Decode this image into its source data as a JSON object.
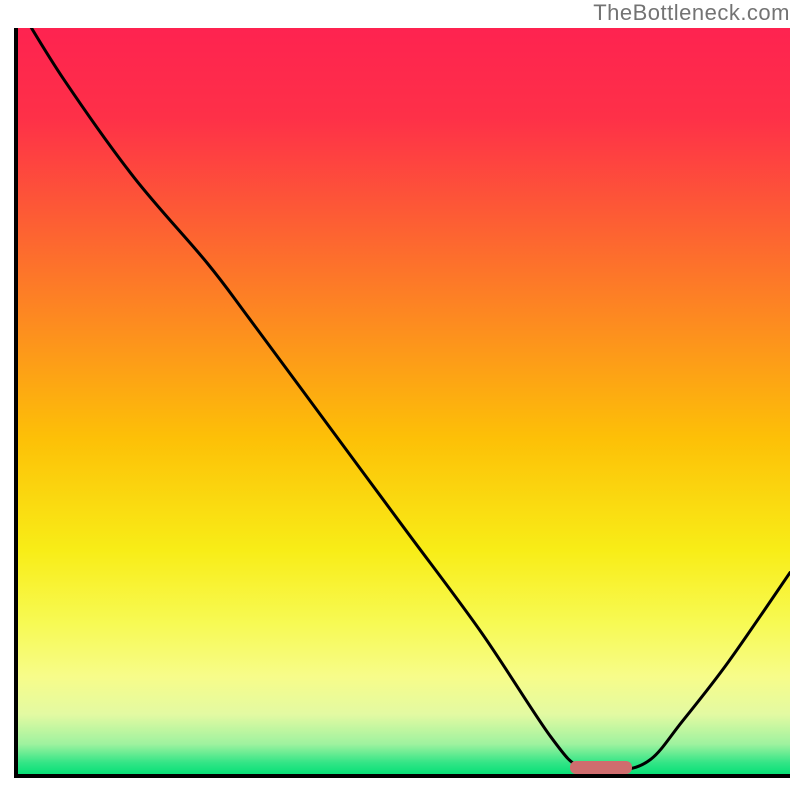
{
  "watermark": "TheBottleneck.com",
  "chart_data": {
    "type": "line",
    "title": "",
    "xlabel": "",
    "ylabel": "",
    "xlim": [
      0,
      100
    ],
    "ylim": [
      0,
      100
    ],
    "gradient_stops": [
      {
        "offset": 0.0,
        "color": "#fe2350"
      },
      {
        "offset": 0.12,
        "color": "#fe3048"
      },
      {
        "offset": 0.25,
        "color": "#fd5b35"
      },
      {
        "offset": 0.4,
        "color": "#fd8d1f"
      },
      {
        "offset": 0.55,
        "color": "#fdc007"
      },
      {
        "offset": 0.7,
        "color": "#f8ed17"
      },
      {
        "offset": 0.8,
        "color": "#f7fa55"
      },
      {
        "offset": 0.87,
        "color": "#f7fc8a"
      },
      {
        "offset": 0.92,
        "color": "#e3faa2"
      },
      {
        "offset": 0.96,
        "color": "#9ef29f"
      },
      {
        "offset": 0.985,
        "color": "#32e586"
      },
      {
        "offset": 1.0,
        "color": "#08e077"
      }
    ],
    "series": [
      {
        "name": "bottleneck-curve",
        "x": [
          0.0,
          6.0,
          15.0,
          24.5,
          30.0,
          40.0,
          50.0,
          60.0,
          69.0,
          73.0,
          78.0,
          82.0,
          86.0,
          92.0,
          100.0
        ],
        "y": [
          103.0,
          93.0,
          80.0,
          68.5,
          61.0,
          47.0,
          33.0,
          19.0,
          5.0,
          0.8,
          0.5,
          2.0,
          7.0,
          15.0,
          27.0
        ]
      }
    ],
    "optimal_marker": {
      "x_start": 71.5,
      "x_end": 79.5,
      "y": 0.9
    }
  }
}
